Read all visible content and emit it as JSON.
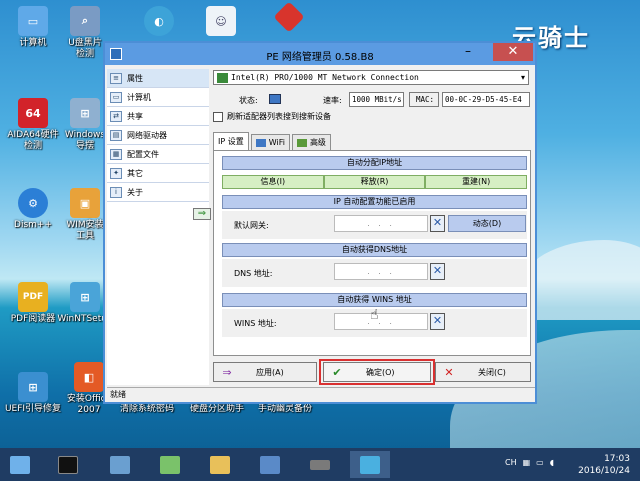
{
  "desktop": {
    "brand": "云骑士",
    "icons": [
      {
        "label": "计算机",
        "icon": "computer-icon",
        "color": "#5fa9e8"
      },
      {
        "label": "U盘黑片\n检测",
        "icon": "usb-search-icon",
        "color": "#7a9bc4"
      },
      {
        "label": "AIDA64硬件\n检测",
        "icon": "aida64-icon",
        "glyph": "64",
        "color": "#d2232a"
      },
      {
        "label": "Windows\n导摆",
        "icon": "windows-install-icon",
        "color": "#8fb0d0"
      },
      {
        "label": "Dism++",
        "icon": "dism-gear-icon",
        "color": "#2b7fd6"
      },
      {
        "label": "WIM安装\n工具",
        "icon": "wim-tool-icon",
        "color": "#e8a23a"
      },
      {
        "label": "PDF阅读器",
        "icon": "pdf-icon",
        "glyph": "PDF",
        "color": "#e8b020"
      },
      {
        "label": "WinNTSetup",
        "icon": "winnt-setup-icon",
        "color": "#4aa4d8"
      },
      {
        "label": "UEFI引导修复",
        "icon": "uefi-repair-icon",
        "color": "#3b8fd0"
      },
      {
        "label": "安装Office\n2007",
        "icon": "office-icon",
        "color": "#e45a25"
      },
      {
        "label": "清除系统密码",
        "icon": "clear-password-icon"
      },
      {
        "label": "硬盘分区助手",
        "icon": "partition-icon"
      },
      {
        "label": "手动幽灵备份",
        "icon": "ghost-backup-icon"
      }
    ],
    "top_icons": [
      {
        "icon": "ghost-icon",
        "color": "#f5f5f5"
      },
      {
        "icon": "disk-tool-icon",
        "color": "#d8342c"
      },
      {
        "icon": "diskgenius-icon",
        "color": "#3da3d8"
      }
    ]
  },
  "window": {
    "title": "PE 网络管理员 0.58.B8",
    "minimize": "–",
    "close": "✕",
    "sidebar": [
      {
        "label": "属性",
        "icon": "properties-icon",
        "selected": true
      },
      {
        "label": "计算机",
        "icon": "computer-small-icon"
      },
      {
        "label": "共享",
        "icon": "share-icon"
      },
      {
        "label": "网络驱动器",
        "icon": "network-drive-icon"
      },
      {
        "label": "配置文件",
        "icon": "config-file-icon"
      },
      {
        "label": "其它",
        "icon": "other-icon"
      },
      {
        "label": "关于",
        "icon": "about-icon"
      }
    ],
    "sidebar_arrow": "⇒",
    "nic": {
      "name": "Intel(R) PRO/1000 MT Network Connection",
      "dropdown": "▾"
    },
    "status_label": "状态:",
    "speed_label": "速率:",
    "speed_value": "1000 MBit/s",
    "mac_label": "MAC:",
    "mac_value": "00-0C-29-D5-45-E4",
    "refresh_label": "刷新适配器列表搜到搜新设备",
    "tabs": [
      {
        "label": "IP 设置",
        "selected": true
      },
      {
        "label": "WiFi",
        "icon": "wifi-icon"
      },
      {
        "label": "高级",
        "icon": "advanced-icon"
      }
    ],
    "sections": {
      "auto_ip": "自动分配IP地址",
      "info_btn": "信息(I)",
      "release_btn": "释放(R)",
      "renew_btn": "重建(N)",
      "auto_ip_enabled": "IP 自动配置功能已启用",
      "gateway_label": "默认网关:",
      "dynamic_btn": "动态(D)",
      "auto_dns": "自动获得DNS地址",
      "dns_label": "DNS 地址:",
      "auto_wins": "自动获得 WINS 地址",
      "wins_label": "WINS 地址:",
      "ip_placeholder": ". . ."
    },
    "buttons": {
      "apply": "应用(A)",
      "ok": "确定(O)",
      "close": "关闭(C)"
    },
    "statusbar": "就绪"
  },
  "taskbar": {
    "lang": "CH",
    "time": "17:03",
    "date": "2016/10/24",
    "apps": [
      "start-icon",
      "cmd-icon",
      "disk-manager-icon",
      "explorer-icon",
      "device-manager-icon",
      "memory-icon",
      "network-manager-icon"
    ]
  }
}
